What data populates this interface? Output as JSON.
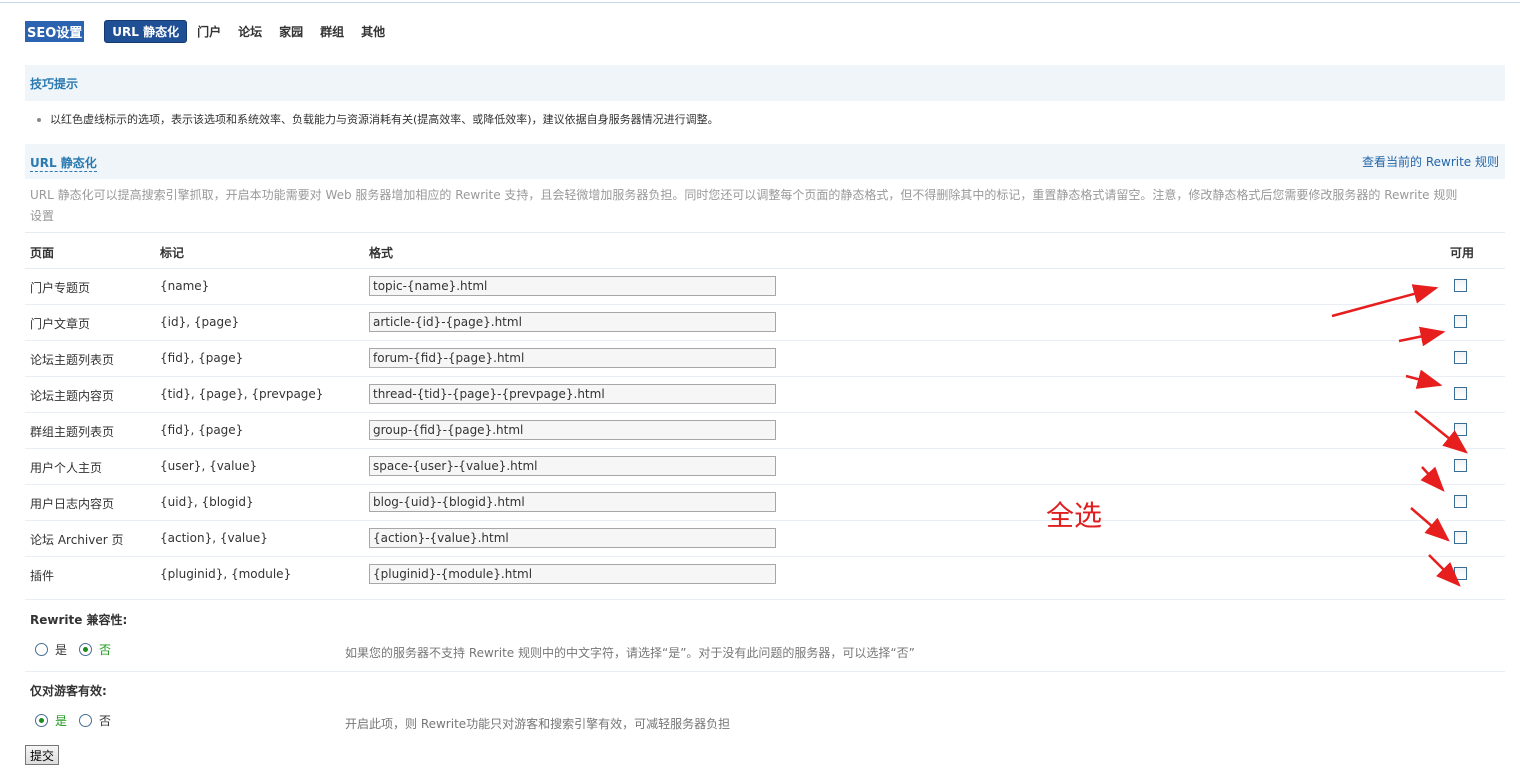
{
  "nav": {
    "brand": "SEO设置",
    "tabs": [
      "URL 静态化",
      "门户",
      "论坛",
      "家园",
      "群组",
      "其他"
    ]
  },
  "tips": {
    "title": "技巧提示",
    "text": "以红色虚线标示的选项，表示该选项和系统效率、负载能力与资源消耗有关(提高效率、或降低效率)，建议依据自身服务器情况进行调整。"
  },
  "url_section": {
    "title": "URL 静态化",
    "link": "查看当前的 Rewrite 规则",
    "description": "URL 静态化可以提高搜索引擎抓取，开启本功能需要对 Web 服务器增加相应的 Rewrite 支持，且会轻微增加服务器负担。同时您还可以调整每个页面的静态格式，但不得删除其中的标记，重置静态格式请留空。注意，修改静态格式后您需要修改服务器的 Rewrite 规则设置"
  },
  "table": {
    "headers": {
      "page": "页面",
      "mark": "标记",
      "format": "格式",
      "enable": "可用"
    },
    "rows": [
      {
        "page": "门户专题页",
        "mark": "{name}",
        "format": "topic-{name}.html",
        "enabled": false
      },
      {
        "page": "门户文章页",
        "mark": "{id}, {page}",
        "format": "article-{id}-{page}.html",
        "enabled": false
      },
      {
        "page": "论坛主题列表页",
        "mark": "{fid}, {page}",
        "format": "forum-{fid}-{page}.html",
        "enabled": false
      },
      {
        "page": "论坛主题内容页",
        "mark": "{tid}, {page}, {prevpage}",
        "format": "thread-{tid}-{page}-{prevpage}.html",
        "enabled": false
      },
      {
        "page": "群组主题列表页",
        "mark": "{fid}, {page}",
        "format": "group-{fid}-{page}.html",
        "enabled": false
      },
      {
        "page": "用户个人主页",
        "mark": "{user}, {value}",
        "format": "space-{user}-{value}.html",
        "enabled": false
      },
      {
        "page": "用户日志内容页",
        "mark": "{uid}, {blogid}",
        "format": "blog-{uid}-{blogid}.html",
        "enabled": false
      },
      {
        "page": "论坛 Archiver 页",
        "mark": "{action}, {value}",
        "format": "{action}-{value}.html",
        "enabled": false
      },
      {
        "page": "插件",
        "mark": "{pluginid}, {module}",
        "format": "{pluginid}-{module}.html",
        "enabled": false
      }
    ]
  },
  "rewrite_compat": {
    "label": "Rewrite 兼容性:",
    "yes": "是",
    "no": "否",
    "selected": "否",
    "hint": "如果您的服务器不支持 Rewrite 规则中的中文字符，请选择“是”。对于没有此问题的服务器，可以选择“否”"
  },
  "guest_only": {
    "label": "仅对游客有效:",
    "yes": "是",
    "no": "否",
    "selected": "是",
    "hint": "开启此项，则 Rewrite功能只对游客和搜索引擎有效，可减轻服务器负担"
  },
  "submit_label": "提交",
  "annotation": {
    "text": "全选",
    "color": "#e02020"
  },
  "colors": {
    "brand": "#2b63b0",
    "active_tab": "#1f4f95",
    "section_title": "#2a7ab0",
    "bar_bg": "#f0f5fa"
  }
}
